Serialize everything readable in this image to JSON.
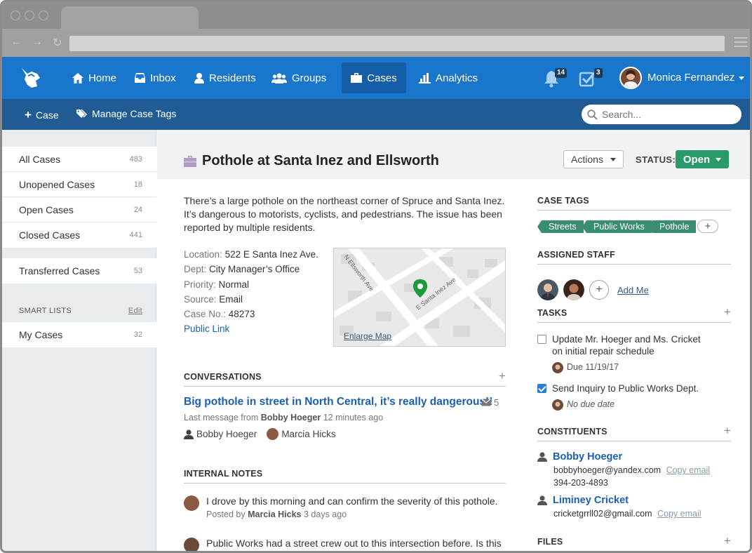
{
  "nav": {
    "home": "Home",
    "inbox": "Inbox",
    "residents": "Residents",
    "groups": "Groups",
    "cases": "Cases",
    "analytics": "Analytics",
    "notifications_count": "14",
    "tasks_count": "3",
    "user_name": "Monica Fernandez"
  },
  "subnav": {
    "new_case": "Case",
    "manage_tags": "Manage Case Tags",
    "search_placeholder": "Search..."
  },
  "sidebar": {
    "groups": [
      {
        "label": "All Cases",
        "count": "483"
      },
      {
        "label": "Unopened Cases",
        "count": "18"
      },
      {
        "label": "Open Cases",
        "count": "24"
      },
      {
        "label": "Closed Cases",
        "count": "441"
      }
    ],
    "transferred": {
      "label": "Transferred Cases",
      "count": "53"
    },
    "smart_lists_label": "SMART LISTS",
    "edit_label": "Edit",
    "my_cases": {
      "label": "My Cases",
      "count": "32"
    }
  },
  "case": {
    "title": "Pothole at Santa Inez and Ellsworth",
    "actions_label": "Actions",
    "status_label": "STATUS:",
    "status_value": "Open",
    "description": "There’s a large pothole on the northeast corner of Spruce and Santa Inez. It’s dangerous to motorists, cyclists, and pedestrians. The issue has been reported by multiple residents.",
    "details": [
      {
        "key": "Location:",
        "value": "522 E Santa Inez Ave."
      },
      {
        "key": "Dept:",
        "value": "City Manager’s Office"
      },
      {
        "key": "Priority:",
        "value": "Normal"
      },
      {
        "key": "Source:",
        "value": "Email"
      },
      {
        "key": "Case No.:",
        "value": "48273"
      }
    ],
    "public_link": "Public Link",
    "map": {
      "street1": "N Ellsworth Ave",
      "street2": "E Santa Inez Ave",
      "enlarge": "Enlarge Map",
      "pin_color": "#1e9a3a"
    }
  },
  "conversations": {
    "heading": "CONVERSATIONS",
    "title": "Big pothole in street in North Central, it’s really dangerous!!",
    "message_count": "5",
    "last_prefix": "Last message from",
    "last_from": "Bobby Hoeger",
    "last_time": "12 minutes ago",
    "participants": [
      "Bobby Hoeger",
      "Marcia Hicks"
    ]
  },
  "notes": {
    "heading": "INTERNAL NOTES",
    "items": [
      {
        "text": "I drove by this morning and can confirm the severity of this pothole.",
        "posted_prefix": "Posted by",
        "author": "Marcia Hicks",
        "time": "3 days ago"
      },
      {
        "text": "Public Works had a street crew out to this intersection before. Is this"
      }
    ]
  },
  "right": {
    "case_tags_heading": "CASE TAGS",
    "tags": [
      "Streets",
      "Public Works",
      "Pothole"
    ],
    "tag_color": "#3b8e6d",
    "assigned_heading": "ASSIGNED STAFF",
    "add_me": "Add Me",
    "tasks_heading": "TASKS",
    "tasks": [
      {
        "line1": "Update Mr. Hoeger and Ms. Cricket",
        "line2": "on initial repair schedule",
        "due": "Due 11/19/17",
        "checked": false
      },
      {
        "line1": "Send Inquiry to Public Works Dept.",
        "line2": "",
        "due": "No due date",
        "checked": true
      }
    ],
    "constituents_heading": "CONSTITUENTS",
    "constituents": [
      {
        "name": "Bobby Hoeger",
        "email": "bobbyhoeger@yandex.com",
        "copy": "Copy email",
        "phone": "394-203-4893"
      },
      {
        "name": "Liminey Cricket",
        "email": "cricketgrrll02@gmail.com",
        "copy": "Copy email"
      }
    ],
    "files_heading": "FILES"
  },
  "colors": {
    "nav_blue": "#1a76cb",
    "subnav_blue": "#1f5c94",
    "status_green": "#2b9a6b",
    "link_blue": "#1a5fb4"
  }
}
